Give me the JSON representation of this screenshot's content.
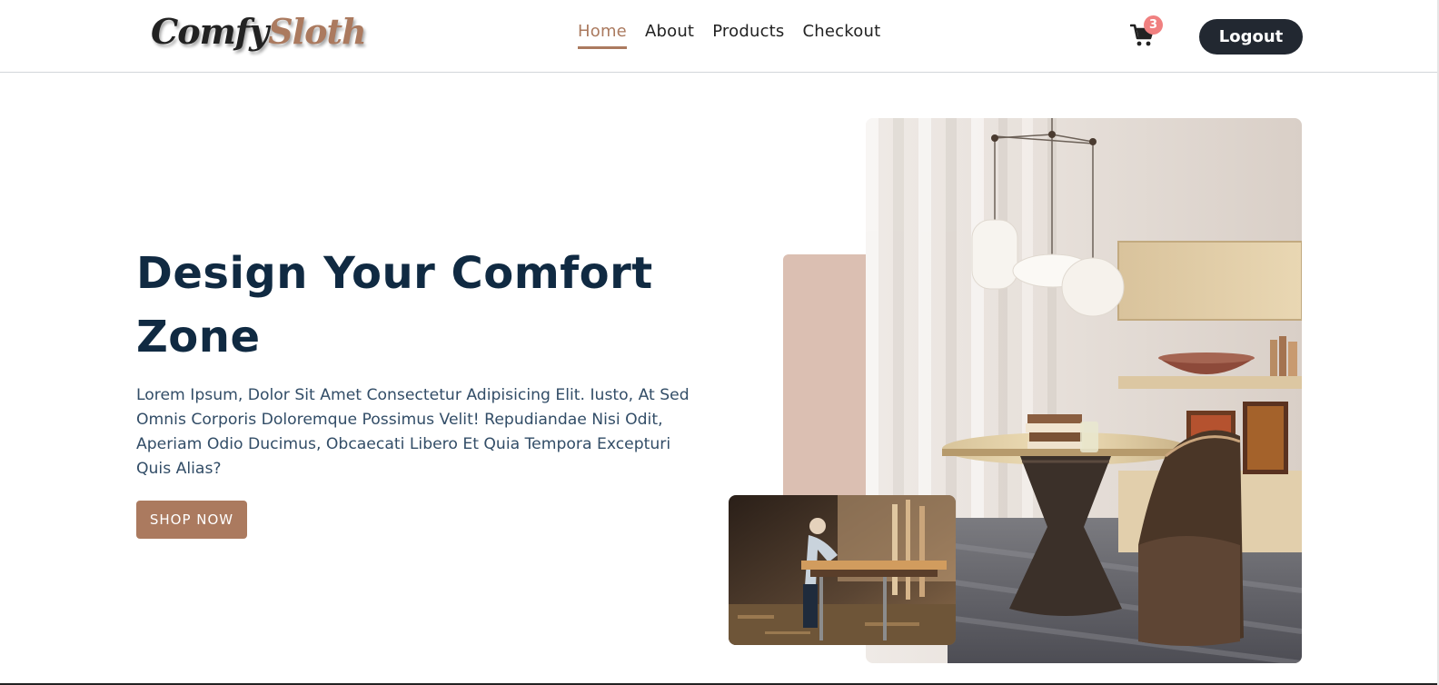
{
  "header": {
    "logo_part1": "Comfy",
    "logo_part2": "Sloth",
    "nav_links": [
      {
        "label": "Home",
        "active": true
      },
      {
        "label": "About",
        "active": false
      },
      {
        "label": "Products",
        "active": false
      },
      {
        "label": "Checkout",
        "active": false
      }
    ],
    "cart_icon": "shopping-cart-icon",
    "cart_count": "3",
    "logout_label": "Logout"
  },
  "hero": {
    "title": "Design Your Comfort Zone",
    "text": "Lorem Ipsum, Dolor Sit Amet Consectetur Adipisicing Elit. Iusto, At Sed Omnis Corporis Doloremque Possimus Velit! Repudiandae Nisi Odit, Aperiam Odio Ducimus, Obcaecati Libero Et Quia Tempora Excepturi Quis Alias?",
    "button_label": "SHOP NOW"
  },
  "colors": {
    "primary": "#ab7a5f",
    "heading": "#102a42",
    "accent_block": "#dbbfb2",
    "badge": "#f08080",
    "dark_button": "#222831"
  }
}
